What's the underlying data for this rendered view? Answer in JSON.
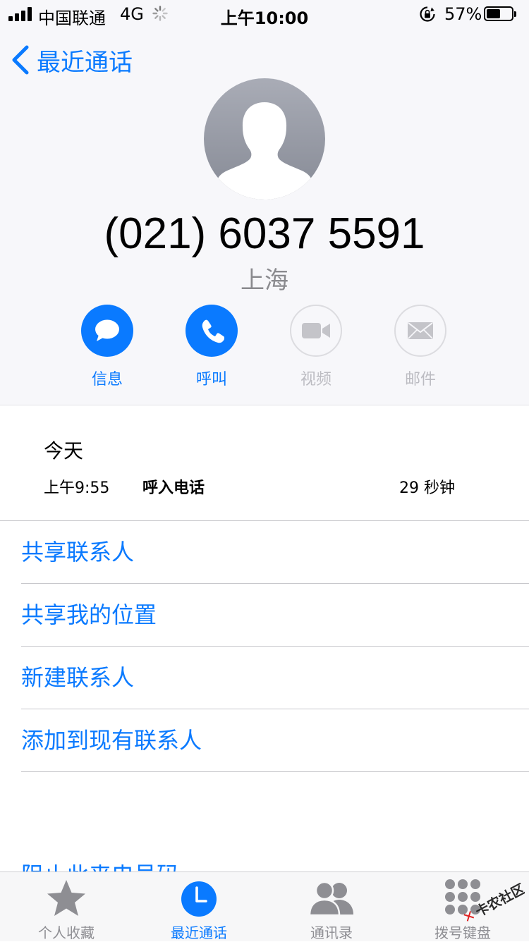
{
  "status_bar": {
    "carrier": "中国联通",
    "network": "4G",
    "time": "上午10:00",
    "battery_percent": "57%",
    "battery_level": 0.57
  },
  "nav": {
    "back_label": "最近通话"
  },
  "contact": {
    "phone_number": "(021) 6037 5591",
    "location": "上海"
  },
  "actions": [
    {
      "label": "信息",
      "icon": "message-bubble-icon",
      "enabled": true
    },
    {
      "label": "呼叫",
      "icon": "phone-handset-icon",
      "enabled": true
    },
    {
      "label": "视频",
      "icon": "video-camera-icon",
      "enabled": false
    },
    {
      "label": "邮件",
      "icon": "envelope-icon",
      "enabled": false
    }
  ],
  "history": {
    "date": "今天",
    "entries": [
      {
        "time": "上午9:55",
        "type": "呼入电话",
        "duration": "29 秒钟"
      }
    ]
  },
  "menu": [
    {
      "label": "共享联系人"
    },
    {
      "label": "共享我的位置"
    },
    {
      "label": "新建联系人"
    },
    {
      "label": "添加到现有联系人"
    }
  ],
  "partial_item": "阻止此来电号码",
  "tab_bar": {
    "tabs": [
      {
        "label": "个人收藏",
        "icon": "star-icon",
        "active": false
      },
      {
        "label": "最近通话",
        "icon": "clock-icon",
        "active": true
      },
      {
        "label": "通讯录",
        "icon": "contacts-icon",
        "active": false
      },
      {
        "label": "拨号键盘",
        "icon": "keypad-icon",
        "active": false
      }
    ]
  },
  "watermark": "卡农社区",
  "colors": {
    "accent": "#0a7aff",
    "disabled": "#bcbcc2",
    "secondary_text": "#8a8a8e",
    "header_background": "#f7f7fa"
  }
}
